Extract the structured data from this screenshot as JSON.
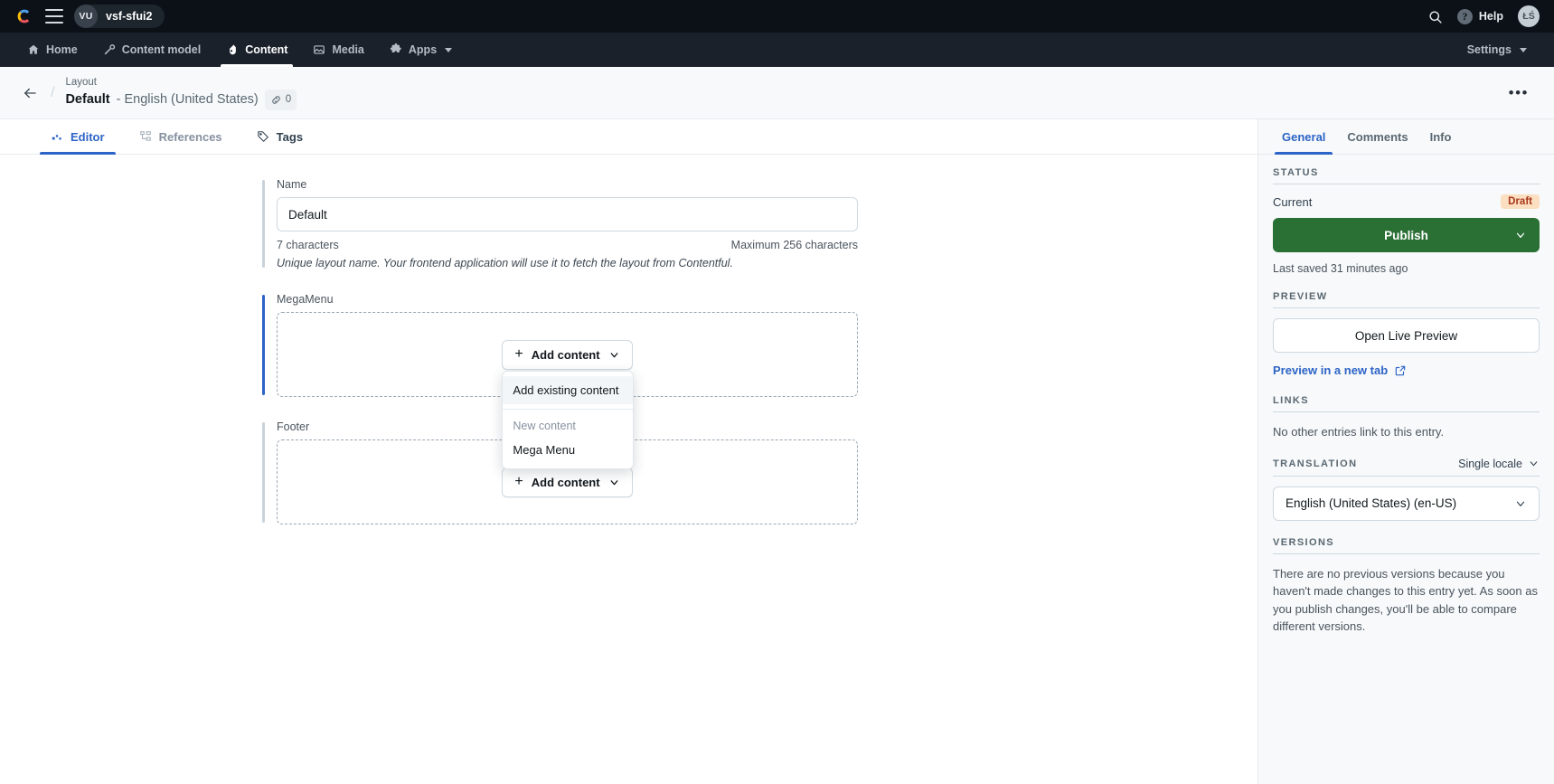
{
  "topbar": {
    "logo_icon": "contentful-logo-icon",
    "menu_icon": "hamburger-menu-icon",
    "space_initials": "VU",
    "space_name": "vsf-sfui2",
    "search_icon": "search-icon",
    "help_icon": "question-mark-icon",
    "help_label": "Help",
    "user_initials": "ŁŚ"
  },
  "nav": {
    "items": [
      {
        "label": "Home",
        "icon": "home-icon",
        "active": false
      },
      {
        "label": "Content model",
        "icon": "wrench-icon",
        "active": false
      },
      {
        "label": "Content",
        "icon": "pen-nib-icon",
        "active": true
      },
      {
        "label": "Media",
        "icon": "image-icon",
        "active": false
      },
      {
        "label": "Apps",
        "icon": "puzzle-icon",
        "active": false,
        "caret": true
      }
    ],
    "settings_label": "Settings"
  },
  "entry_header": {
    "back_icon": "back-arrow-icon",
    "separator": "/",
    "kicker": "Layout",
    "name": "Default",
    "locale": "- English (United States)",
    "link_icon": "link-chain-icon",
    "link_count": "0",
    "more_icon": "ellipsis-icon"
  },
  "editor_tabs": [
    {
      "label": "Editor",
      "icon": "editor-blocks-icon",
      "active": true
    },
    {
      "label": "References",
      "icon": "references-tree-icon",
      "active": false
    },
    {
      "label": "Tags",
      "icon": "tag-icon",
      "active": false
    }
  ],
  "form": {
    "name_field": {
      "label": "Name",
      "value": "Default",
      "placeholder": "",
      "char_count": "7 characters",
      "max_note": "Maximum 256 characters",
      "help": "Unique layout name. Your frontend application will use it to fetch the layout from Contentful."
    },
    "megamenu_field": {
      "label": "MegaMenu",
      "add_button": "Add content",
      "plus_icon": "plus-icon",
      "caret_icon": "chevron-down-icon"
    },
    "footer_field": {
      "label": "Footer",
      "add_button": "Add content",
      "plus_icon": "plus-icon",
      "caret_icon": "chevron-down-icon"
    }
  },
  "dropdown": {
    "existing_label": "Add existing content",
    "group_heading": "New content",
    "items": [
      "Mega Menu"
    ]
  },
  "sidebar": {
    "tabs": [
      {
        "label": "General",
        "active": true
      },
      {
        "label": "Comments",
        "active": false
      },
      {
        "label": "Info",
        "active": false
      }
    ],
    "status": {
      "section": "STATUS",
      "current_label": "Current",
      "badge": "Draft",
      "publish_label": "Publish",
      "publish_caret_icon": "chevron-down-icon",
      "last_saved": "Last saved 31 minutes ago"
    },
    "preview": {
      "section": "PREVIEW",
      "open_live_label": "Open Live Preview",
      "new_tab_label": "Preview in a new tab",
      "external_icon": "external-link-icon"
    },
    "links": {
      "section": "LINKS",
      "empty_text": "No other entries link to this entry."
    },
    "translation": {
      "section": "TRANSLATION",
      "mode_label": "Single locale",
      "mode_caret_icon": "chevron-down-icon",
      "selected_locale": "English (United States) (en-US)",
      "select_caret_icon": "chevron-down-icon"
    },
    "versions": {
      "section": "VERSIONS",
      "empty_text": "There are no previous versions because you haven't made changes to this entry yet. As soon as you publish changes, you'll be able to compare different versions."
    }
  },
  "colors": {
    "topbar_bg": "#0b1117",
    "navbar_bg": "#1a212b",
    "accent_blue": "#2d64c7",
    "publish_green": "#2a7035",
    "draft_badge_bg": "#fbdfc0",
    "draft_badge_text": "#a8371b",
    "sidebar_bg": "#f7f9fa"
  }
}
